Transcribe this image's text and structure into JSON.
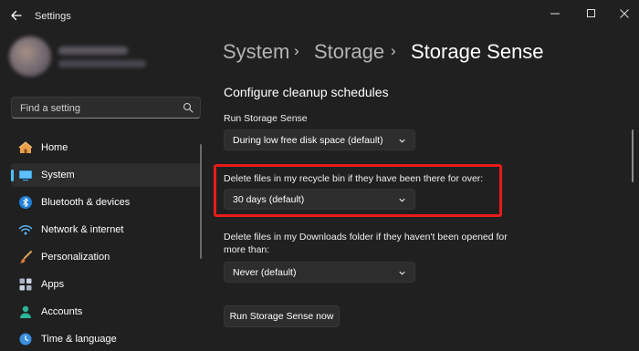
{
  "app": {
    "title": "Settings"
  },
  "window_controls": {
    "minimize_icon": "minimize-icon",
    "maximize_icon": "maximize-icon",
    "close_icon": "close-icon"
  },
  "search": {
    "placeholder": "Find a setting",
    "value": ""
  },
  "sidebar": {
    "items": [
      {
        "label": "Home",
        "icon": "home-icon",
        "selected": false
      },
      {
        "label": "System",
        "icon": "system-icon",
        "selected": true
      },
      {
        "label": "Bluetooth & devices",
        "icon": "bluetooth-icon",
        "selected": false
      },
      {
        "label": "Network & internet",
        "icon": "wifi-icon",
        "selected": false
      },
      {
        "label": "Personalization",
        "icon": "brush-icon",
        "selected": false
      },
      {
        "label": "Apps",
        "icon": "apps-icon",
        "selected": false
      },
      {
        "label": "Accounts",
        "icon": "accounts-icon",
        "selected": false
      },
      {
        "label": "Time & language",
        "icon": "time-language-icon",
        "selected": false
      }
    ]
  },
  "breadcrumb": {
    "items": [
      "System",
      "Storage",
      "Storage Sense"
    ],
    "separator": "›"
  },
  "main": {
    "section_title": "Configure cleanup schedules",
    "run_storage_sense": {
      "label": "Run Storage Sense",
      "value": "During low free disk space (default)"
    },
    "recycle_bin": {
      "label": "Delete files in my recycle bin if they have been there for over:",
      "value": "30 days (default)"
    },
    "downloads": {
      "label_line1": "Delete files in my Downloads folder if they haven't been opened for",
      "label_line2": "more than:",
      "value": "Never (default)"
    },
    "run_now_button": "Run Storage Sense now"
  },
  "colors": {
    "background": "#202020",
    "accent": "#4cc2ff",
    "highlight": "#e81b1b",
    "control": "#2d2d2d"
  }
}
